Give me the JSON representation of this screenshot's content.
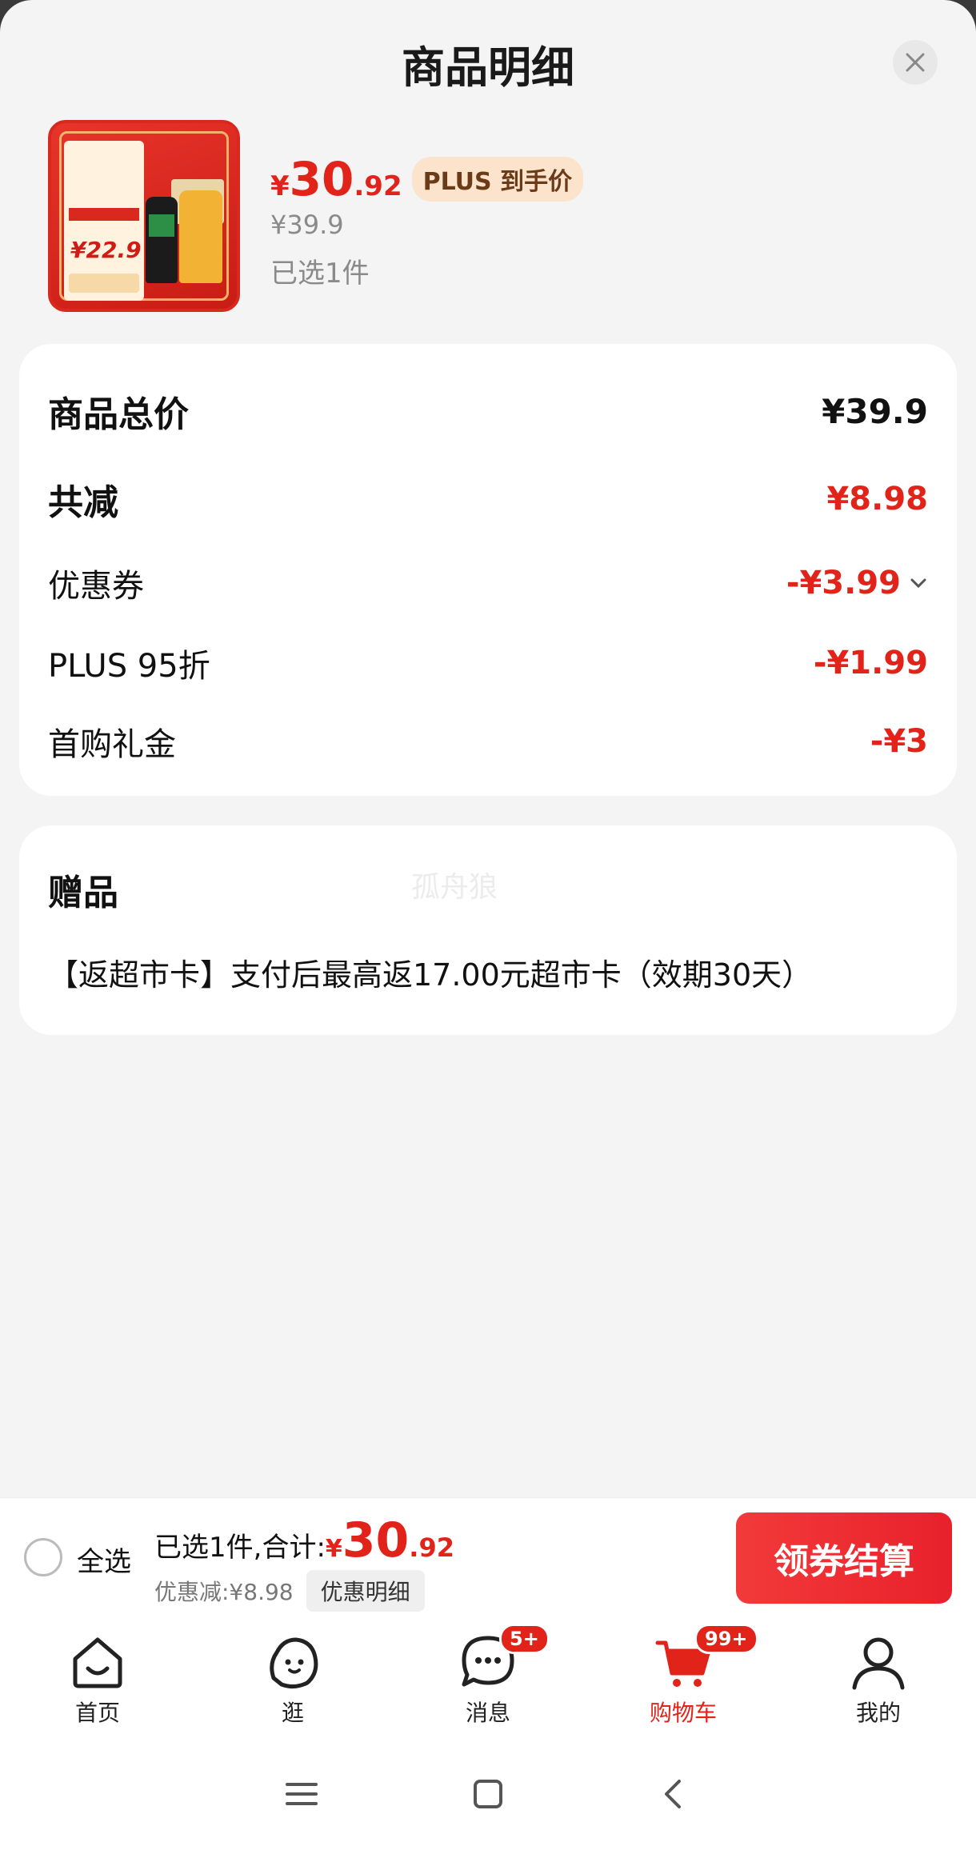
{
  "header": {
    "title": "商品明细"
  },
  "product": {
    "price_currency": "¥",
    "price_int": "30",
    "price_dec": ".92",
    "plus_tag": "PLUS 到手价",
    "original_price": "¥39.9",
    "selected_count": "已选1件"
  },
  "summary": {
    "total_label": "商品总价",
    "total_value": "¥39.9",
    "reduce_label": "共减",
    "reduce_value": "¥8.98",
    "coupon_label": "优惠券",
    "coupon_value": "-¥3.99",
    "plus_label": "PLUS 95折",
    "plus_value": "-¥1.99",
    "first_label": "首购礼金",
    "first_value": "-¥3"
  },
  "gift": {
    "title": "赠品",
    "watermark": "孤舟狼",
    "text": "【返超市卡】支付后最高返17.00元超市卡（效期30天）"
  },
  "bottom_bar": {
    "select_all": "全选",
    "selected_total_label": "已选1件,合计:",
    "currency": "¥",
    "total_int": "30",
    "total_dec": ".92",
    "discount_text": "优惠减:¥8.98",
    "detail_button": "优惠明细",
    "checkout_button": "领券结算"
  },
  "tabbar": {
    "items": [
      {
        "label": "首页",
        "icon": "home-icon"
      },
      {
        "label": "逛",
        "icon": "explore-icon"
      },
      {
        "label": "消息",
        "icon": "message-icon",
        "badge": "5+"
      },
      {
        "label": "购物车",
        "icon": "cart-icon",
        "badge": "99+",
        "active": true
      },
      {
        "label": "我的",
        "icon": "profile-icon"
      }
    ]
  },
  "colors": {
    "accent": "#e2231a",
    "plus_tag_bg": "#fbe3cc"
  }
}
